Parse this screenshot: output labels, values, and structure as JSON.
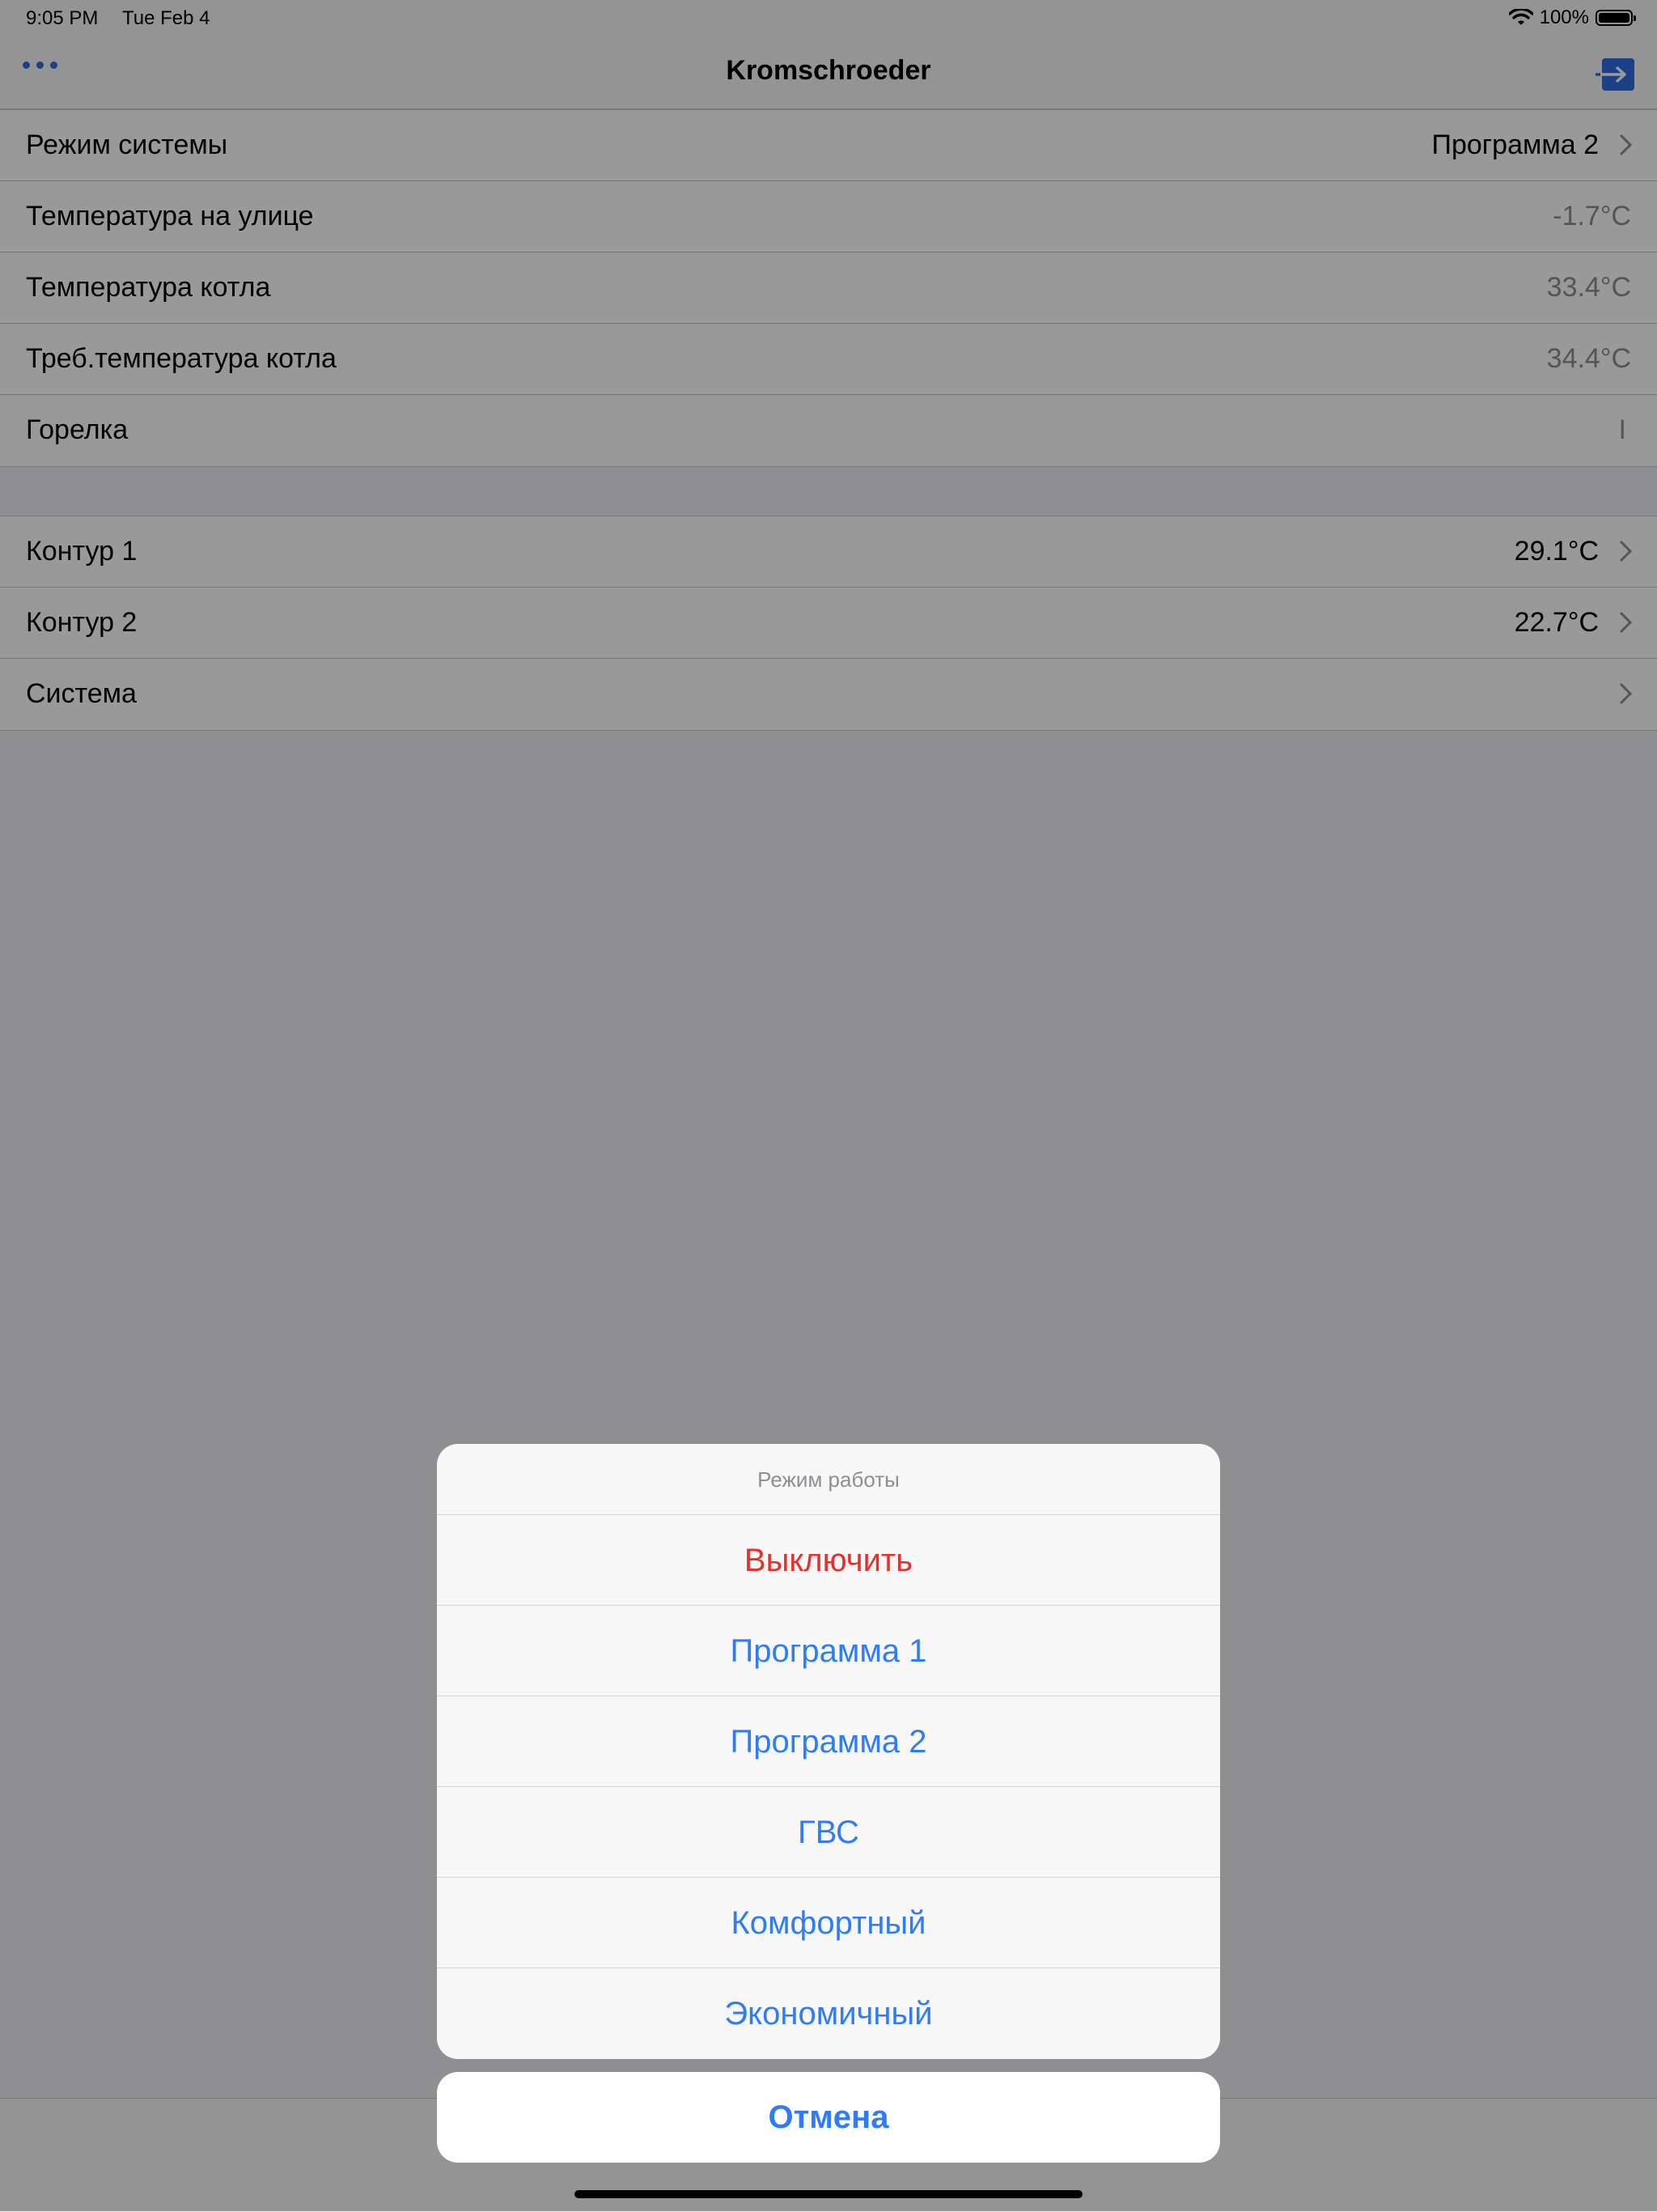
{
  "status_bar": {
    "time": "9:05 PM",
    "date": "Tue Feb 4",
    "battery_percent": "100%"
  },
  "nav": {
    "title": "Kromschroeder",
    "more_icon": "ellipsis-icon",
    "exit_icon": "logout-arrow-icon"
  },
  "main_list": {
    "rows": [
      {
        "label": "Режим системы",
        "value": "Программа 2"
      },
      {
        "label": "Температура на улице",
        "value": "-1.7°C"
      },
      {
        "label": "Температура котла",
        "value": "33.4°C"
      },
      {
        "label": "Треб.температура котла",
        "value": "34.4°C"
      },
      {
        "label": "Горелка",
        "value": "I"
      }
    ]
  },
  "circuits_list": {
    "rows": [
      {
        "label": "Контур 1",
        "value": "29.1°C"
      },
      {
        "label": "Контур 2",
        "value": "22.7°C"
      },
      {
        "label": "Система",
        "value": ""
      }
    ]
  },
  "action_sheet": {
    "title": "Режим работы",
    "options": [
      {
        "label": "Выключить",
        "style": "destructive"
      },
      {
        "label": "Программа 1",
        "style": "default"
      },
      {
        "label": "Программа 2",
        "style": "default"
      },
      {
        "label": "ГВС",
        "style": "default"
      },
      {
        "label": "Комфортный",
        "style": "default"
      },
      {
        "label": "Экономичный",
        "style": "default"
      }
    ],
    "cancel_label": "Отмена"
  },
  "colors": {
    "accent": "#2f7cf6",
    "destructive": "#e5302b"
  }
}
